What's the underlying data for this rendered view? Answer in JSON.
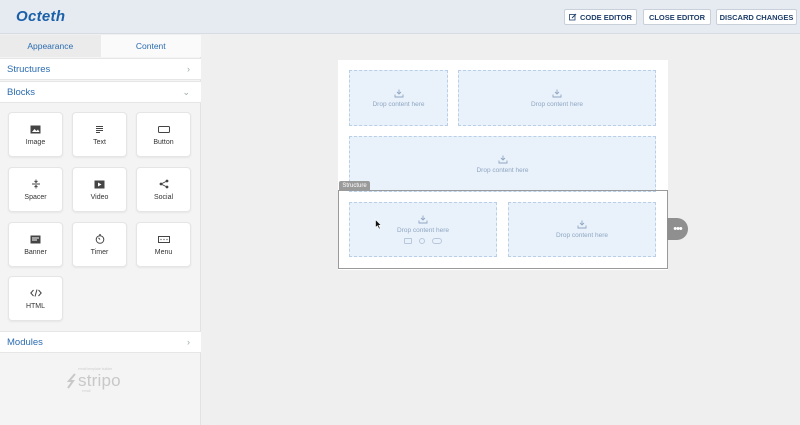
{
  "app": {
    "brand": "Octeth"
  },
  "toolbar": {
    "code_editor": "CODE EDITOR",
    "close_editor": "CLOSE EDITOR",
    "discard_changes": "DISCARD CHANGES"
  },
  "panel": {
    "tabs": [
      "Appearance",
      "Content"
    ],
    "active_tab": "Content",
    "sections": {
      "structures": "Structures",
      "blocks": "Blocks",
      "modules": "Modules"
    },
    "blocks": [
      {
        "label": "Image",
        "icon": "image-icon"
      },
      {
        "label": "Text",
        "icon": "text-icon"
      },
      {
        "label": "Button",
        "icon": "button-icon"
      },
      {
        "label": "Spacer",
        "icon": "spacer-icon"
      },
      {
        "label": "Video",
        "icon": "video-icon"
      },
      {
        "label": "Social",
        "icon": "share-icon"
      },
      {
        "label": "Banner",
        "icon": "banner-icon"
      },
      {
        "label": "Timer",
        "icon": "timer-icon"
      },
      {
        "label": "Menu",
        "icon": "menu-icon"
      },
      {
        "label": "HTML",
        "icon": "code-icon"
      }
    ],
    "powered_by": {
      "top": "email template builder",
      "word": "stripo",
      "bottom": "email"
    }
  },
  "canvas": {
    "drop_label": "Drop content here",
    "structure_label": "Structure",
    "more_label": "•••"
  },
  "colors": {
    "accent": "#2b6cb0",
    "drop_bg": "#e9f1fb",
    "header_bg": "#e6ebf2"
  }
}
